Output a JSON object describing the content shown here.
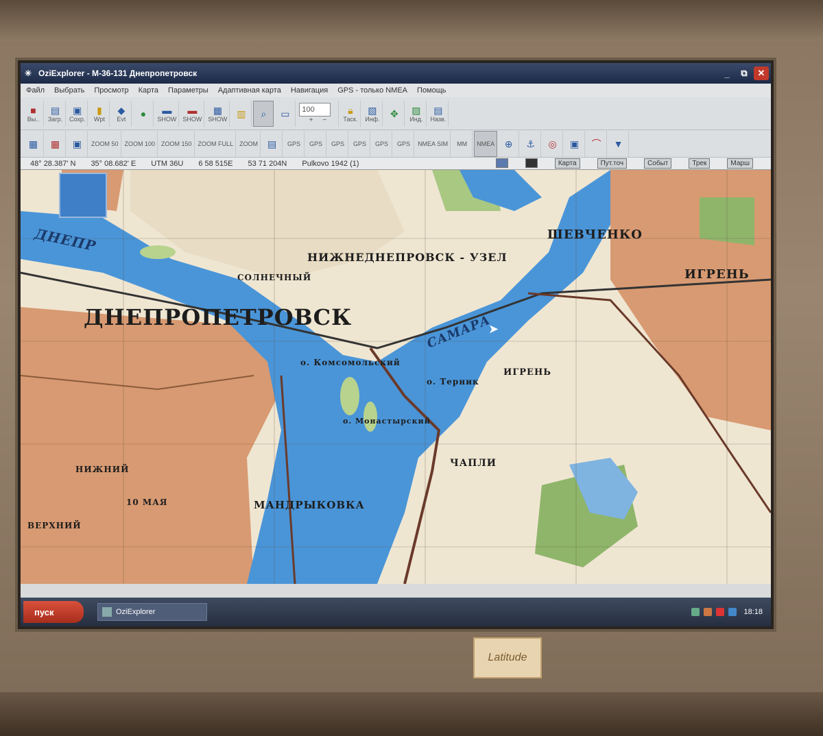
{
  "window": {
    "title": "OziExplorer - M-36-131 Днепропетровск",
    "minimize": "_",
    "maximize": "⧉",
    "close": "✕"
  },
  "menu": [
    "Файл",
    "Выбрать",
    "Просмотр",
    "Карта",
    "Параметры",
    "Адаптивная карта",
    "Навигация",
    "GPS - только NMEA",
    "Помощь"
  ],
  "toolbar1": {
    "buttons": [
      {
        "label": "Вы..",
        "icon": "exit-icon"
      },
      {
        "label": "Загр.",
        "icon": "load-icon"
      },
      {
        "label": "Сохр.",
        "icon": "save-icon"
      },
      {
        "label": "Wpt",
        "icon": "waypoint-icon"
      },
      {
        "label": "Evt",
        "icon": "event-icon"
      },
      {
        "label": "",
        "icon": "route-icon"
      },
      {
        "label": "SHOW",
        "icon": "show-icon"
      },
      {
        "label": "SHOW",
        "icon": "show-track-icon"
      },
      {
        "label": "SHOW",
        "icon": "show-all-icon"
      },
      {
        "label": "",
        "icon": "layers-icon"
      },
      {
        "label": "",
        "icon": "find-icon"
      },
      {
        "label": "",
        "icon": "window-icon"
      }
    ],
    "zoom_value": "100",
    "zoom_in": "+",
    "zoom_out": "−",
    "task_label": "Таск.",
    "info_label": "Инф.",
    "ind_label": "Инд.",
    "name_label": "Назв."
  },
  "toolbar2": {
    "buttons": [
      "ZOOM 50",
      "ZOOM 100",
      "ZOOM 150",
      "ZOOM FULL",
      "ZOOM",
      "GPS",
      "GPS",
      "GPS",
      "GPS",
      "GPS",
      "GPS",
      "NMEA SIM",
      "MM",
      "NMEA",
      "",
      "",
      "",
      "",
      "",
      ""
    ]
  },
  "status": {
    "lat": "48° 28.387' N",
    "lon": "35° 08.682' E",
    "utm": "UTM 36U",
    "easting": "6 58 515E",
    "northing": "53 71 204N",
    "datum": "Pulkovo 1942 (1)",
    "tabs": [
      "Карта",
      "Пут.точ",
      "Событ",
      "Трек",
      "Марш"
    ]
  },
  "map_labels": {
    "city": "ДНЕПРОПЕТРОВСК",
    "dnepr": "ДНЕПР",
    "nizhnedneprovsk": "НИЖНЕДНЕПРОВСК - УЗЕЛ",
    "shevchenko": "ШЕВЧЕНКО",
    "igren_top": "ИГРЕНЬ",
    "igren": "ИГРЕНЬ",
    "samara": "САМАРА",
    "solnechny": "СОЛНЕЧНЫЙ",
    "komsomolsky": "о. Комсомольский",
    "ternik": "о. Терник",
    "mandrykovka": "МАНДРЫКОВКА",
    "monastyrsky": "о. Монастырский",
    "chaply": "ЧАПЛИ",
    "nizhny": "НИЖНИЙ",
    "verkhny": "ВЕРХНИЙ",
    "desna": "10 МАЯ"
  },
  "taskbar": {
    "start": "пуск",
    "task": "OziExplorer",
    "clock": "18:18"
  },
  "laptop": {
    "badge": "Latitude"
  },
  "colors": {
    "water": "#4a95d8",
    "urban": "#d89a72",
    "forest": "#8fb56a",
    "land": "#efe6d2",
    "road": "#6a3a2a"
  }
}
